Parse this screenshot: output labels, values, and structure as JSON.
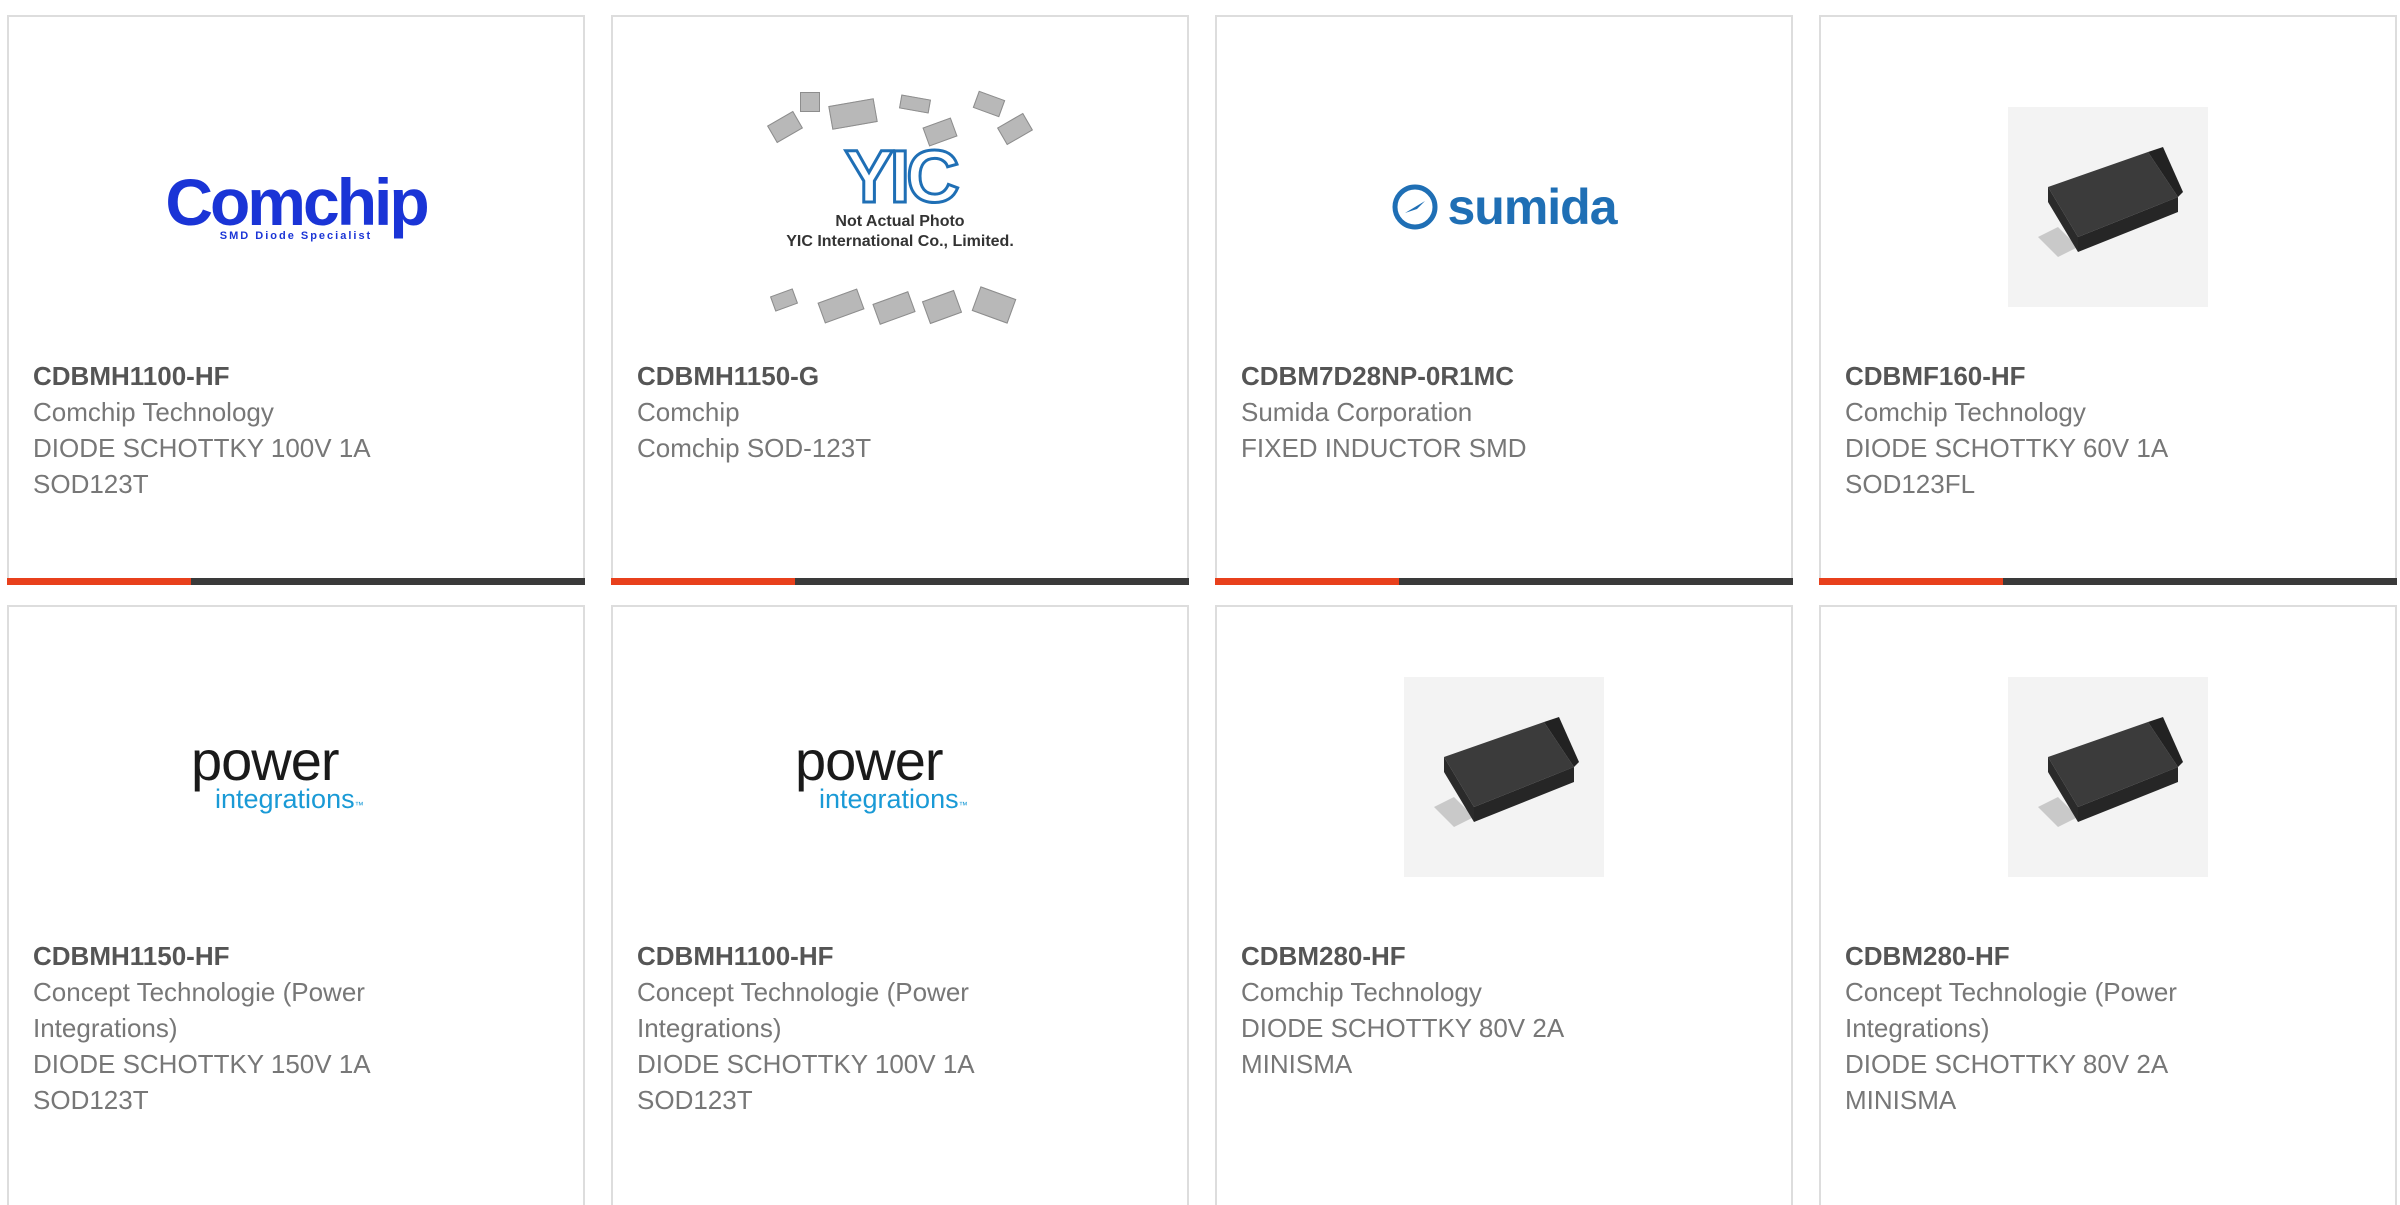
{
  "colors": {
    "accent": "#e8401c",
    "bar": "#3a3a3a",
    "border": "#dddddd",
    "title": "#555555",
    "text": "#777777"
  },
  "products": [
    {
      "part": "CDBMH1100-HF",
      "manufacturer": "Comchip Technology",
      "description": "DIODE SCHOTTKY 100V 1A SOD123T",
      "image": "comchip-logo",
      "logo_text": "Comchip",
      "logo_tag": "SMD Diode Specialist"
    },
    {
      "part": "CDBMH1150-G",
      "manufacturer": "Comchip",
      "description": "Comchip SOD-123T",
      "image": "yic-placeholder",
      "logo_text": "YIC",
      "caption_line1": "Not Actual Photo",
      "caption_line2": "YIC International Co., Limited."
    },
    {
      "part": "CDBM7D28NP-0R1MC",
      "manufacturer": "Sumida Corporation",
      "description": "FIXED INDUCTOR SMD",
      "image": "sumida-logo",
      "logo_text": "sumida"
    },
    {
      "part": "CDBMF160-HF",
      "manufacturer": "Comchip Technology",
      "description": "DIODE SCHOTTKY 60V 1A SOD123FL",
      "image": "diode-package-photo"
    },
    {
      "part": "CDBMH1150-HF",
      "manufacturer": "Concept Technologie (Power Integrations)",
      "description": "DIODE SCHOTTKY 150V 1A SOD123T",
      "image": "power-integrations-logo",
      "logo_text": "power",
      "logo_sub": "integrations",
      "logo_tm": "™"
    },
    {
      "part": "CDBMH1100-HF",
      "manufacturer": "Concept Technologie (Power Integrations)",
      "description": "DIODE SCHOTTKY 100V 1A SOD123T",
      "image": "power-integrations-logo",
      "logo_text": "power",
      "logo_sub": "integrations",
      "logo_tm": "™"
    },
    {
      "part": "CDBM280-HF",
      "manufacturer": "Comchip Technology",
      "description": "DIODE SCHOTTKY 80V 2A MINISMA",
      "image": "diode-package-photo"
    },
    {
      "part": "CDBM280-HF",
      "manufacturer": "Concept Technologie (Power Integrations)",
      "description": "DIODE SCHOTTKY 80V 2A MINISMA",
      "image": "diode-package-photo"
    }
  ]
}
